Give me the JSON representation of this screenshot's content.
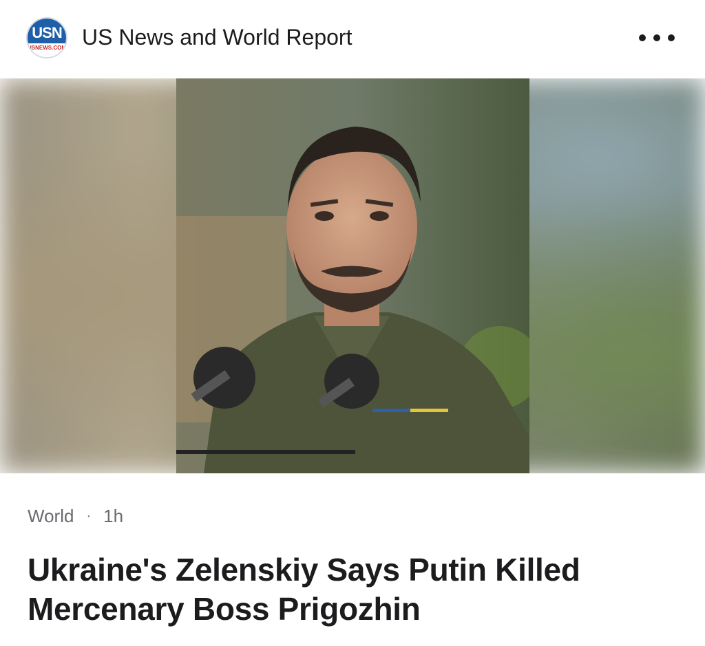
{
  "header": {
    "logo_text_top": "USN",
    "logo_text_bottom": "USNEWS.COM",
    "source_name": "US News and World Report",
    "more_icon": "ellipsis-icon"
  },
  "hero": {
    "image_icon": "photo"
  },
  "meta": {
    "category": "World",
    "separator": "·",
    "time": "1h"
  },
  "article": {
    "headline": "Ukraine's Zelenskiy Says Putin Killed Mercenary Boss Prigozhin"
  },
  "colors": {
    "logo_blue": "#1d5fa8",
    "logo_red": "#c3272b",
    "text_primary": "#1c1c1e",
    "text_secondary": "#6b6b70"
  }
}
